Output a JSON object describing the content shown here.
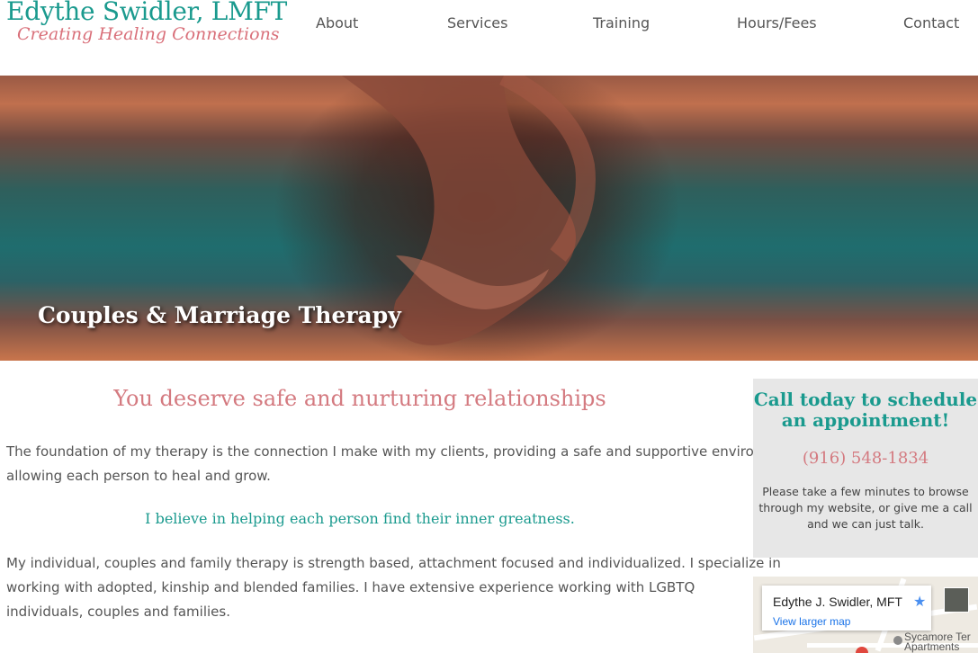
{
  "brand": {
    "name": "Edythe Swidler, LMFT",
    "tagline": "Creating Healing Connections"
  },
  "nav": {
    "items": [
      "About",
      "Services",
      "Training",
      "Hours/Fees",
      "Contact"
    ]
  },
  "hero": {
    "title": "Couples & Marriage Therapy"
  },
  "main": {
    "heading": "You deserve safe and nurturing relationships",
    "paragraph1_lines": [
      "The foundation of my therapy is the connection I make with my clients, providing a safe and supportive environment",
      "allowing each person to heal and grow."
    ],
    "quote": "I believe in helping each person find their inner greatness.",
    "paragraph2_lines": [
      "My individual, couples and family therapy is strength based, attachment focused and individualized. I specialize in",
      "working with adopted, kinship and blended families. I have extensive experience working with LGBTQ",
      "individuals, couples and families."
    ]
  },
  "sidebar": {
    "cta_heading_lines": [
      "Call today to schedule",
      "an appointment!"
    ],
    "phone": "(916) 548-1834",
    "text_lines": [
      "Please take a few minutes to browse",
      "through my website, or give me a call",
      "and we can just talk."
    ]
  },
  "map": {
    "place_name": "Edythe J. Swidler, MFT",
    "link": "View larger map",
    "pin_label_lines": [
      "Sycamore Ter",
      "Apartments"
    ]
  },
  "colors": {
    "teal": "#1a9a8e",
    "rose": "#d47a80",
    "text": "#555555"
  }
}
